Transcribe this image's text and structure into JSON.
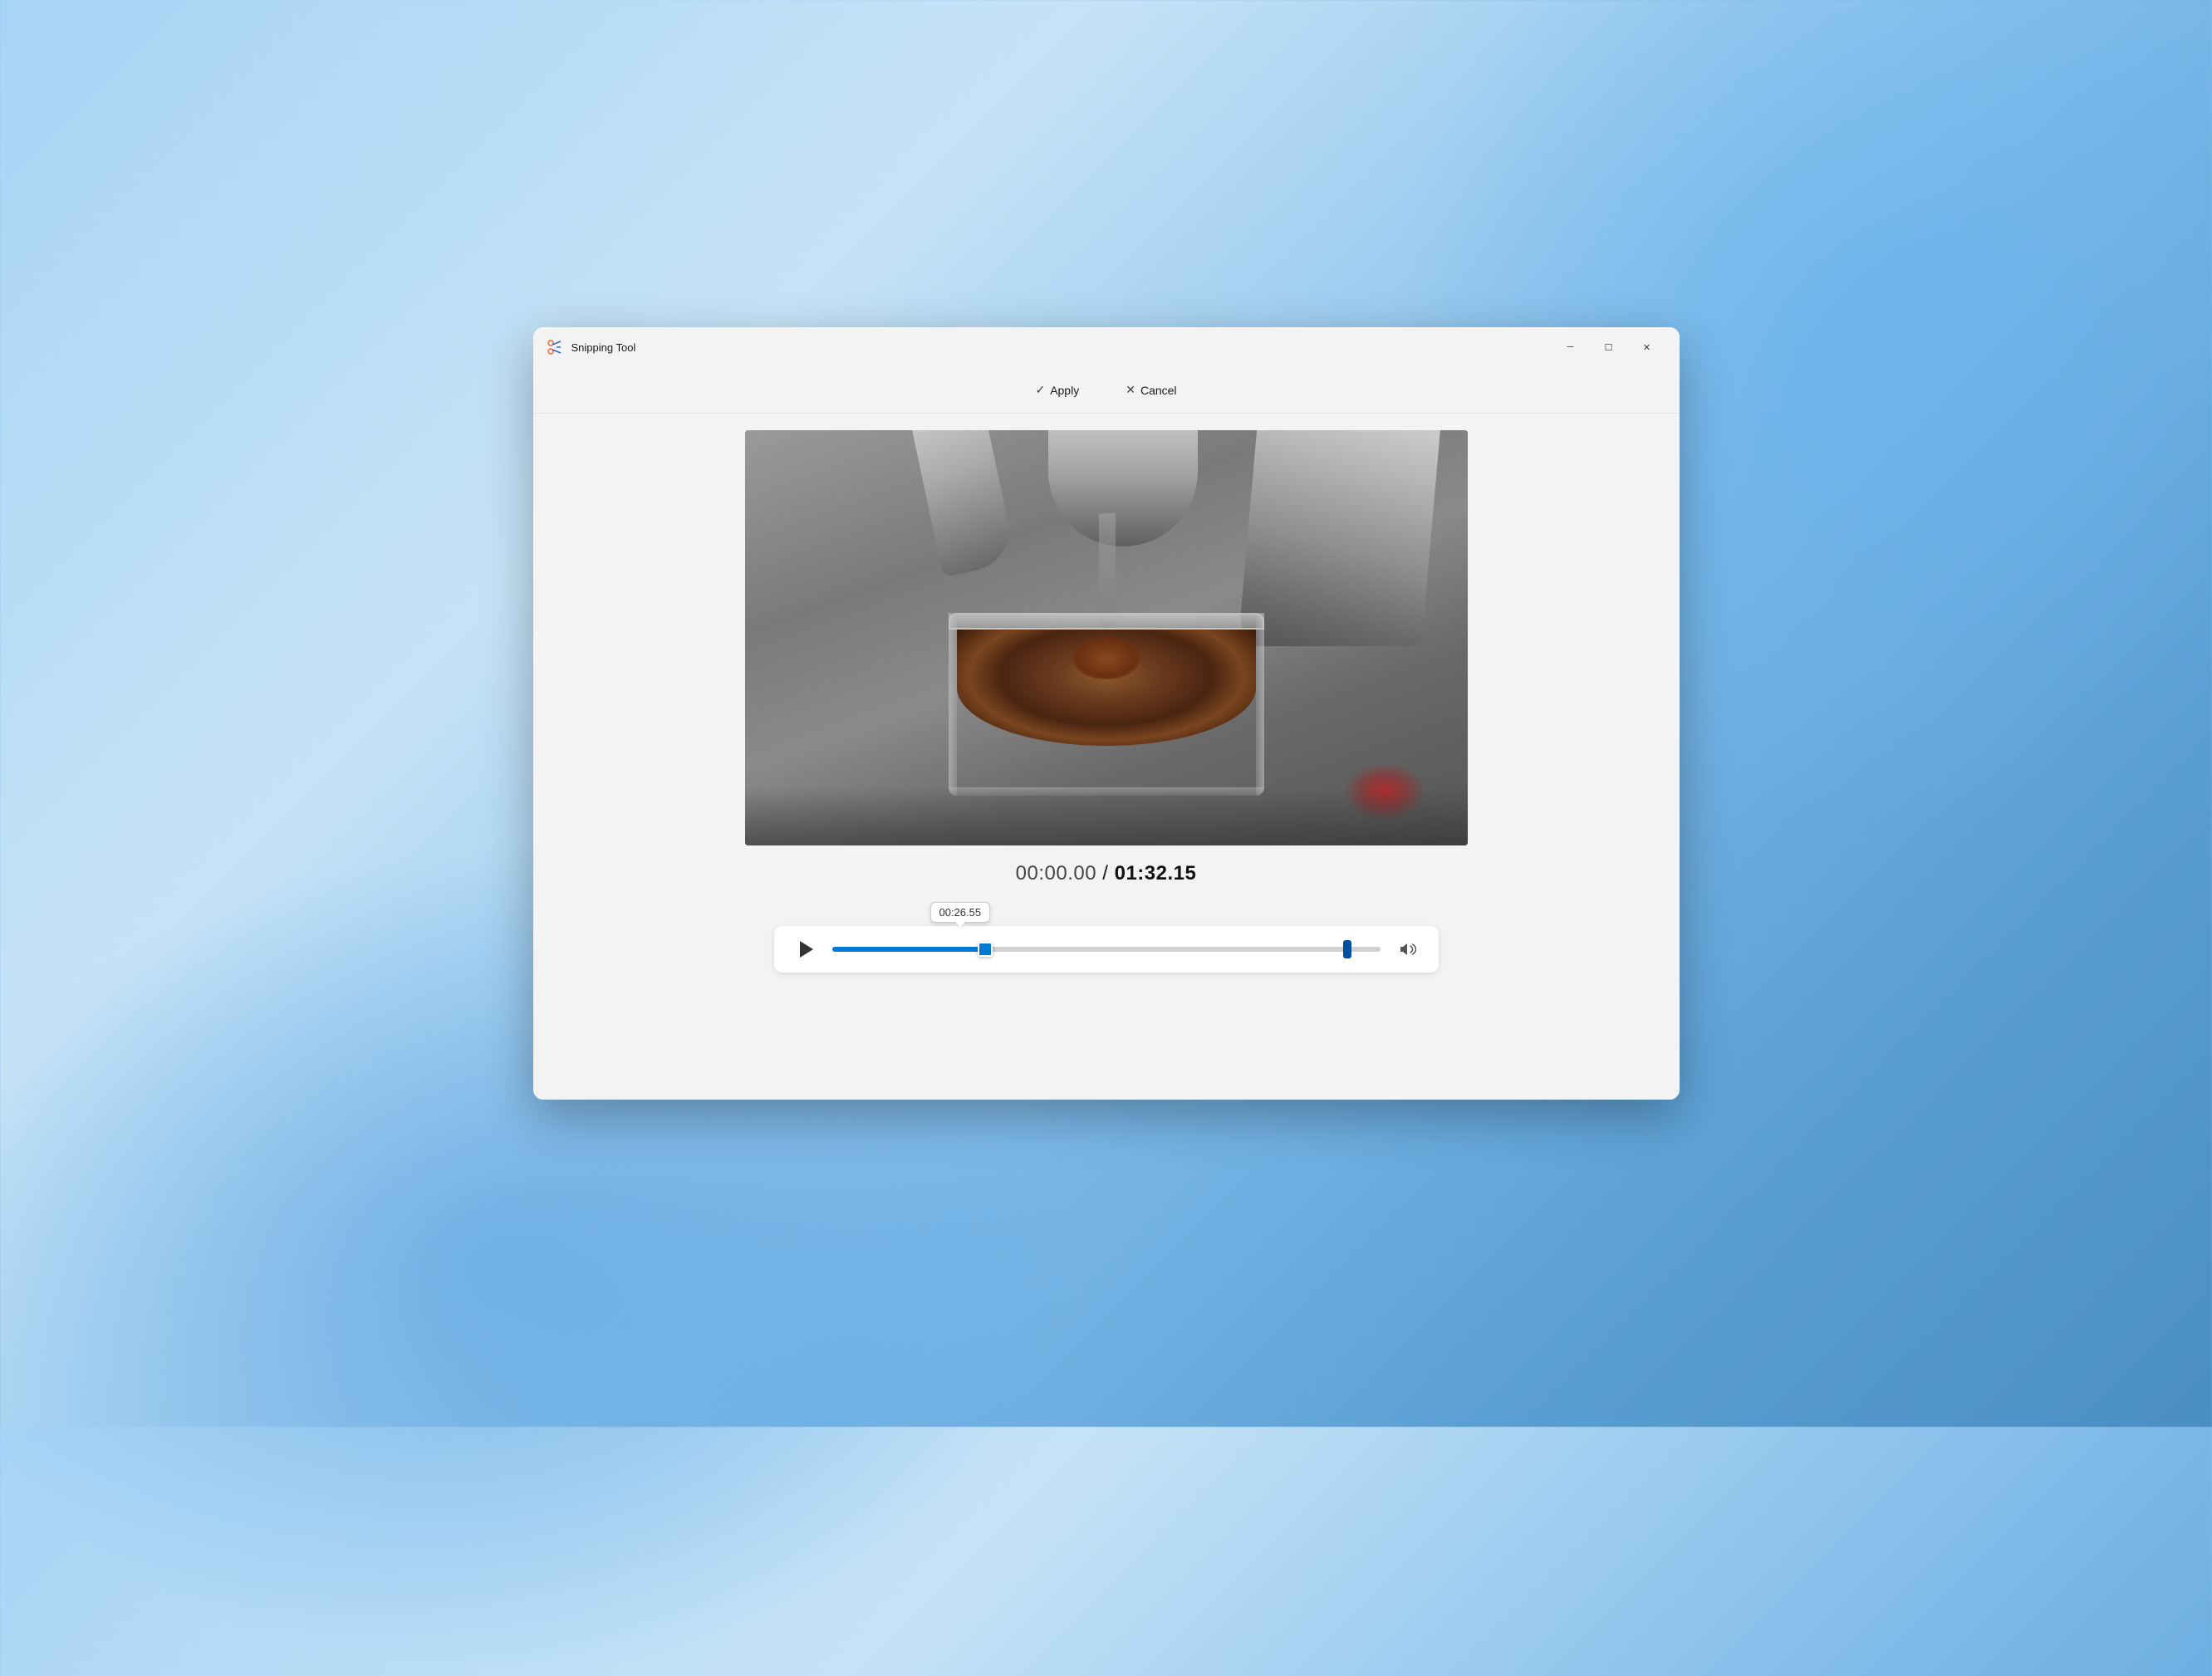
{
  "app": {
    "title": "Snipping Tool",
    "icon": "scissors"
  },
  "window_controls": {
    "minimize": "─",
    "maximize": "☐",
    "close": "✕"
  },
  "toolbar": {
    "apply_label": "Apply",
    "cancel_label": "Cancel",
    "apply_icon": "✓",
    "cancel_icon": "✕"
  },
  "video": {
    "current_time": "00:00.00",
    "total_time": "01:32.15",
    "time_separator": " / ",
    "scrubber_position_percent": 28,
    "trim_right_percent": 94,
    "tooltip_time": "00:26.55"
  },
  "player": {
    "play_label": "Play",
    "volume_label": "Volume"
  }
}
